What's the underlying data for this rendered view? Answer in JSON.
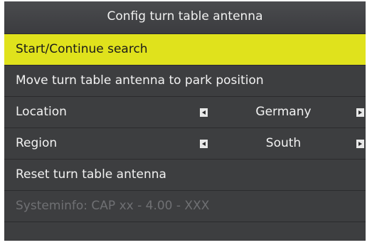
{
  "title": "Config turn table antenna",
  "menu": {
    "start_search": "Start/Continue search",
    "park_position": "Move turn table antenna to park position",
    "location": {
      "label": "Location",
      "value": "Germany"
    },
    "region": {
      "label": "Region",
      "value": "South"
    },
    "reset": "Reset turn table antenna",
    "systeminfo": "Systeminfo: CAP xx  - 4.00 - XXX"
  },
  "colors": {
    "highlight": "#e0e21c",
    "row_background": "#3d3e40",
    "disabled_text": "#6f7073"
  },
  "icons": {
    "prev": "arrow-left-icon",
    "next": "arrow-right-icon"
  }
}
